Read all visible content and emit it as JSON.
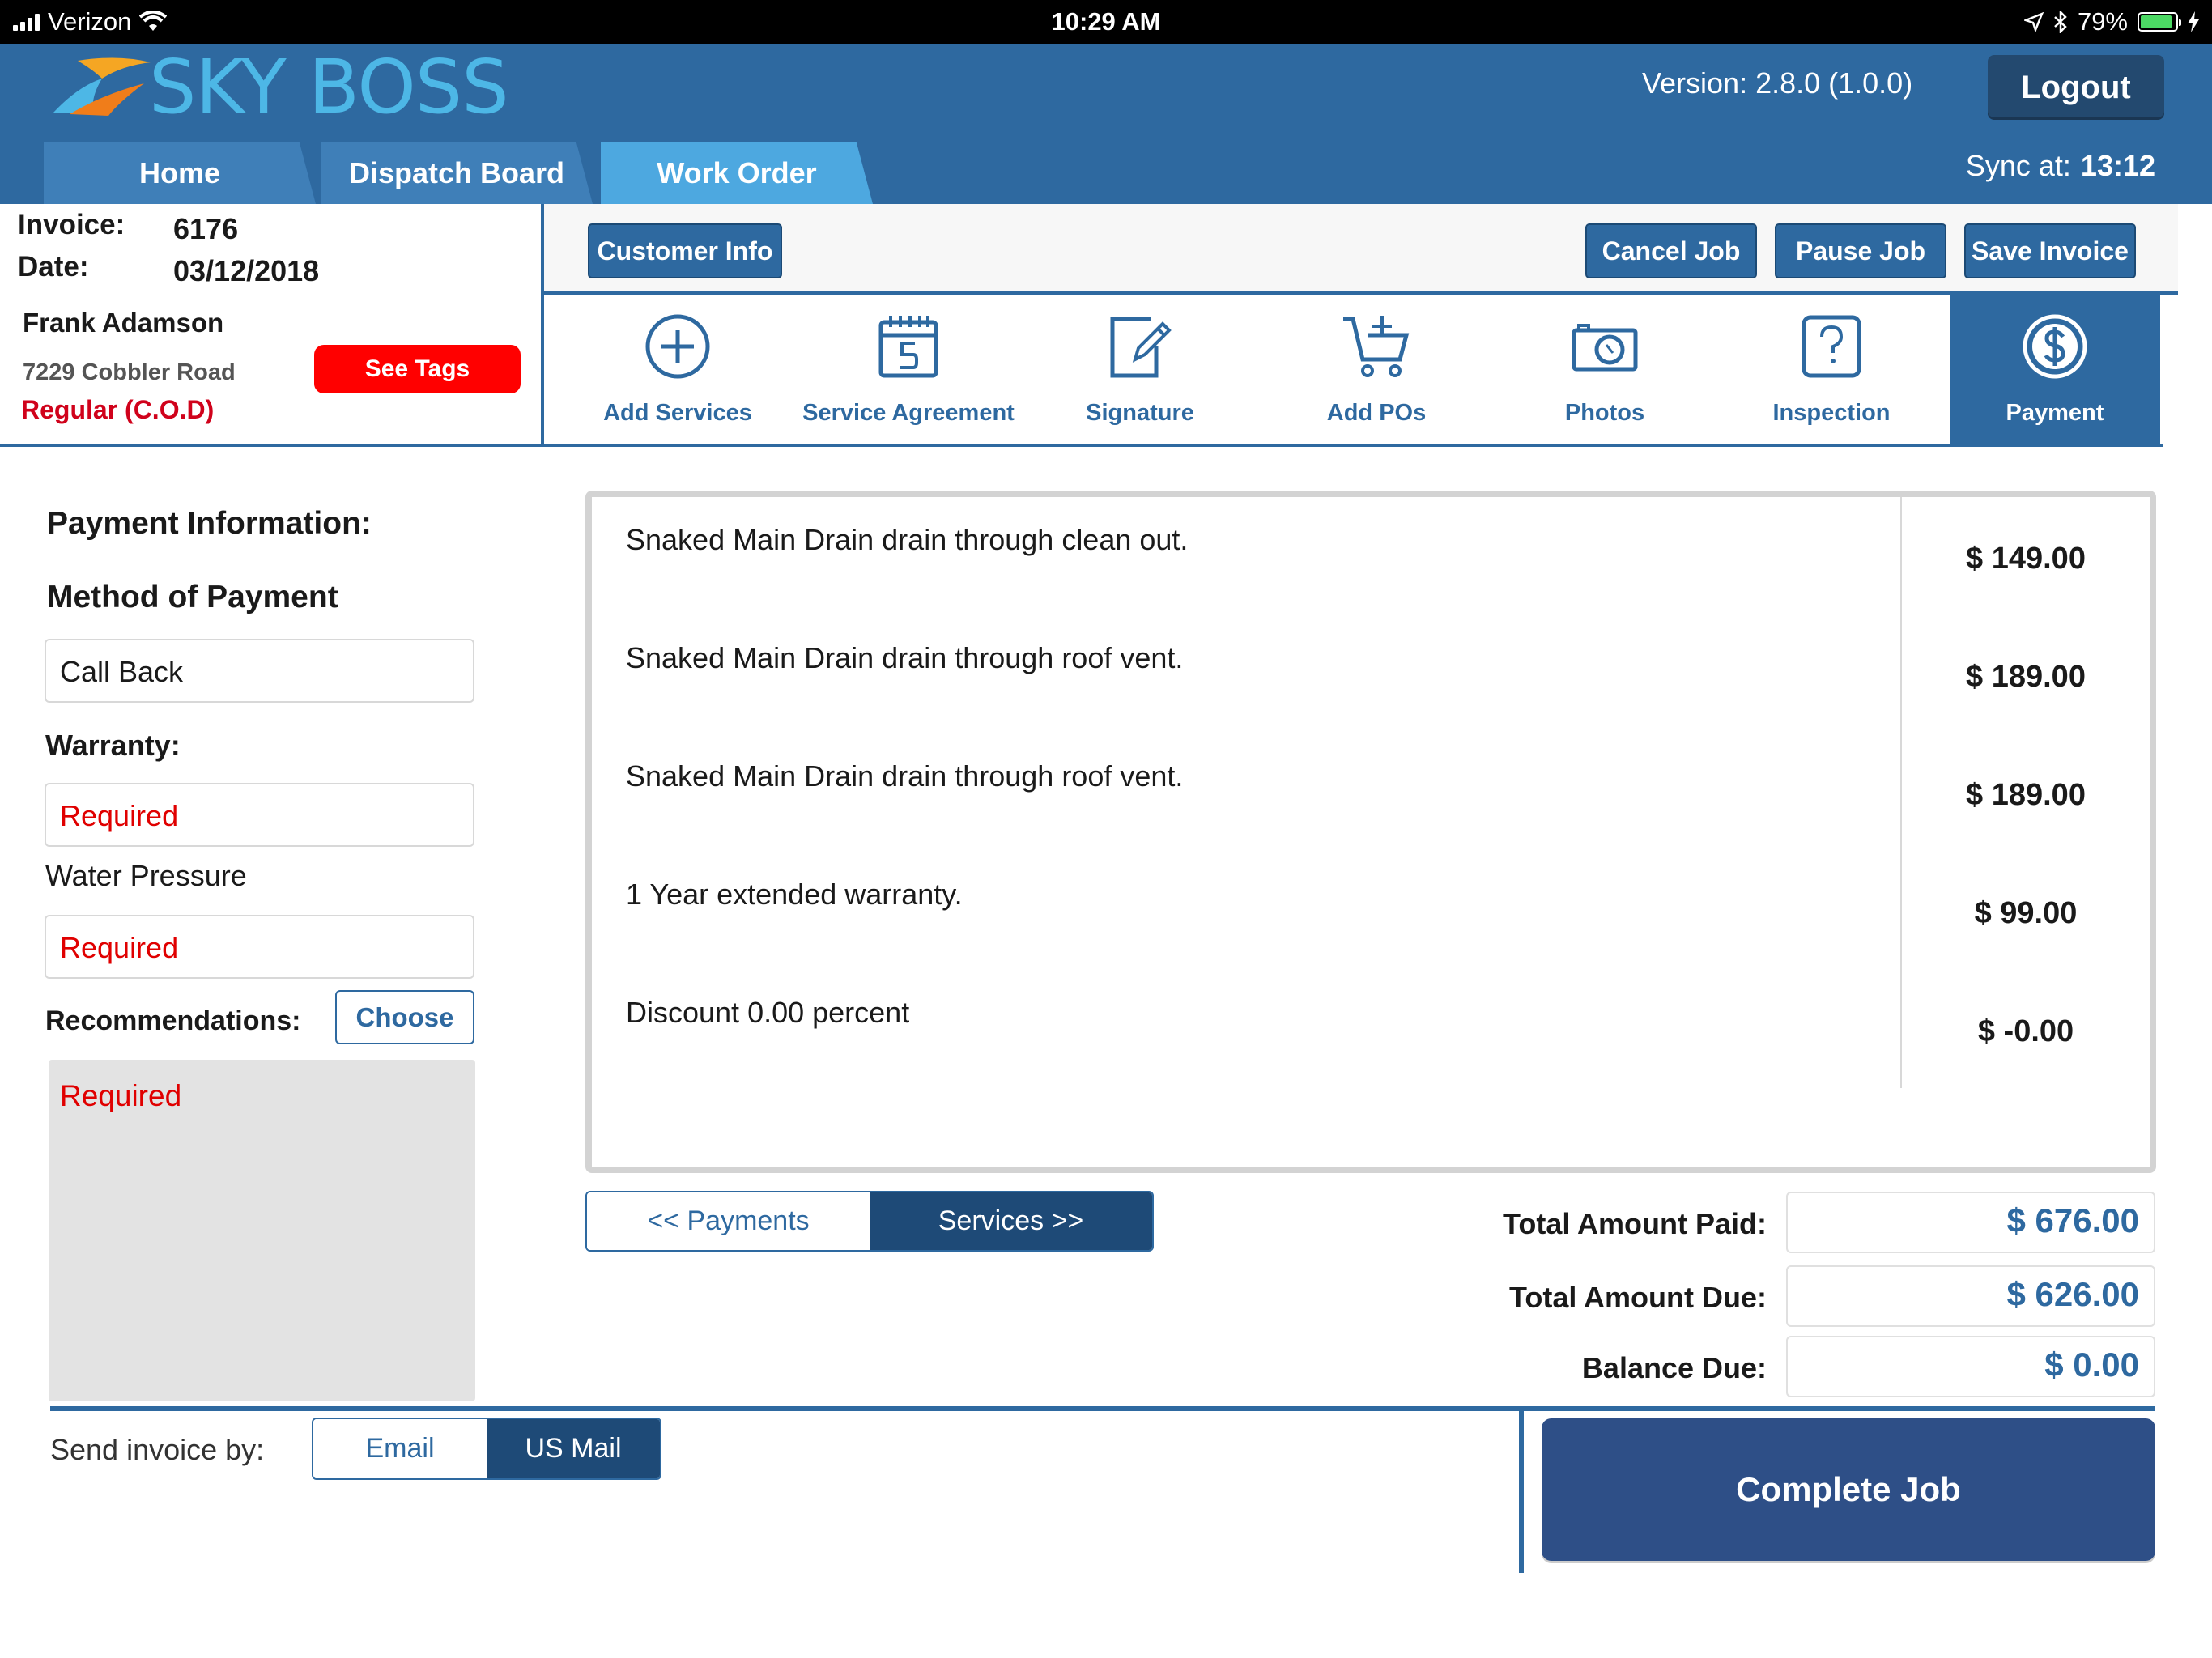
{
  "statusbar": {
    "carrier": "Verizon",
    "time": "10:29 AM",
    "battery": "79%"
  },
  "header": {
    "app_name": "SKY BOSS",
    "version": "Version: 2.8.0 (1.0.0)",
    "logout_label": "Logout"
  },
  "tabs": [
    {
      "label": "Home"
    },
    {
      "label": "Dispatch Board"
    },
    {
      "label": "Work Order"
    }
  ],
  "sync": {
    "label": "Sync at:",
    "time": "13:12"
  },
  "invoice": {
    "invoice_label": "Invoice:",
    "invoice_number": "6176",
    "date_label": "Date:",
    "date": "03/12/2018",
    "customer_name": "Frank Adamson",
    "address": "7229 Cobbler Road",
    "plan": "Regular (C.O.D)",
    "see_tags_label": "See Tags"
  },
  "actions": {
    "customer_info": "Customer Info",
    "cancel_job": "Cancel Job",
    "pause_job": "Pause Job",
    "save_invoice": "Save Invoice"
  },
  "nav_items": [
    {
      "label": "Add Services",
      "icon": "plus-circle-icon"
    },
    {
      "label": "Service Agreement",
      "icon": "calendar-icon"
    },
    {
      "label": "Signature",
      "icon": "pencil-document-icon"
    },
    {
      "label": "Add POs",
      "icon": "cart-plus-icon"
    },
    {
      "label": "Photos",
      "icon": "camera-icon"
    },
    {
      "label": "Inspection",
      "icon": "question-icon"
    },
    {
      "label": "Payment",
      "icon": "dollar-circle-icon",
      "active": true
    }
  ],
  "payment_form": {
    "title": "Payment Information:",
    "method_label": "Method of Payment",
    "method_value": "Call Back",
    "warranty_label": "Warranty:",
    "warranty_value": "Required",
    "water_pressure_label": "Water Pressure",
    "water_pressure_value": "Required",
    "recommendations_label": "Recommendations:",
    "choose_label": "Choose",
    "recommendations_value": "Required"
  },
  "services": [
    {
      "description": "Snaked Main Drain drain through clean out.",
      "price": "$ 149.00"
    },
    {
      "description": "Snaked Main Drain drain through roof vent.",
      "price": "$ 189.00"
    },
    {
      "description": "Snaked Main Drain drain through roof vent.",
      "price": "$ 189.00"
    },
    {
      "description": "1 Year extended warranty.",
      "price": "$ 99.00"
    },
    {
      "description": "Discount 0.00 percent",
      "price": "$ -0.00"
    }
  ],
  "pager": {
    "payments_label": "<< Payments",
    "services_label": "Services >>",
    "selected": "Services >>"
  },
  "totals": {
    "paid_label": "Total Amount Paid:",
    "paid_value": "$ 676.00",
    "due_label": "Total Amount Due:",
    "due_value": "$ 626.00",
    "balance_label": "Balance Due:",
    "balance_value": "$ 0.00"
  },
  "send_invoice": {
    "label": "Send invoice by:",
    "email_label": "Email",
    "mail_label": "US Mail",
    "selected": "US Mail"
  },
  "complete_job_label": "Complete Job",
  "colors": {
    "brand_blue": "#2e69a0",
    "dark_blue": "#1e4a77",
    "accent_light_blue": "#4db7e6",
    "required_red": "#e00000",
    "tag_red": "#ff0000"
  }
}
